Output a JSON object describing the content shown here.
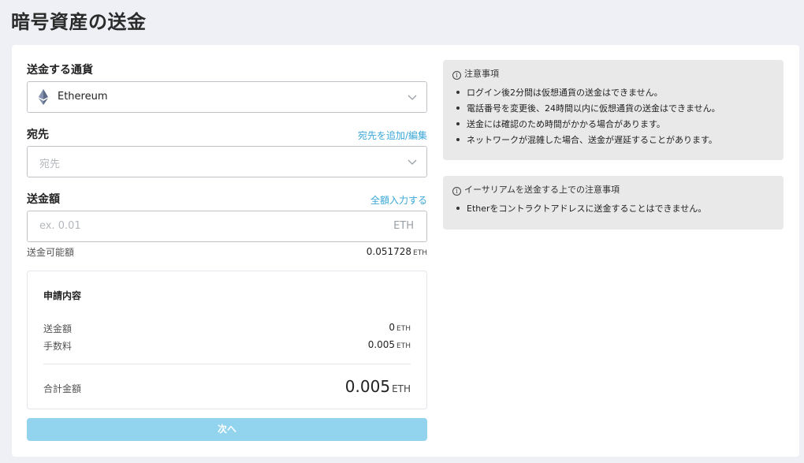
{
  "page": {
    "title": "暗号資産の送金"
  },
  "currency": {
    "label": "送金する通貨",
    "selected": "Ethereum",
    "icon": "ethereum-icon"
  },
  "destination": {
    "label": "宛先",
    "link": "宛先を追加/編集",
    "placeholder": "宛先"
  },
  "amount": {
    "label": "送金額",
    "link": "全額入力する",
    "placeholder": "ex. 0.01",
    "unit": "ETH",
    "available_label": "送金可能額",
    "available_value": "0.051728",
    "available_unit": "ETH"
  },
  "summary": {
    "title": "申請内容",
    "send_label": "送金額",
    "send_value": "0",
    "send_unit": "ETH",
    "fee_label": "手数料",
    "fee_value": "0.005",
    "fee_unit": "ETH",
    "total_label": "合計金額",
    "total_value": "0.005",
    "total_unit": "ETH"
  },
  "next_button": {
    "label": "次へ",
    "color": "#92d3ee"
  },
  "notice_general": {
    "title": "注意事項",
    "items": [
      "ログイン後2分間は仮想通貨の送金はできません。",
      "電話番号を変更後、24時間以内に仮想通貨の送金はできません。",
      "送金には確認のため時間がかかる場合があります。",
      "ネットワークが混雑した場合、送金が遅延することがあります。"
    ]
  },
  "notice_eth": {
    "title": "イーサリアムを送金する上での注意事項",
    "items": [
      "Etherをコントラクトアドレスに送金することはできません。"
    ]
  },
  "colors": {
    "accent": "#3aa7d8",
    "background": "#eef0f5",
    "notice_bg": "#e9e9ea"
  }
}
